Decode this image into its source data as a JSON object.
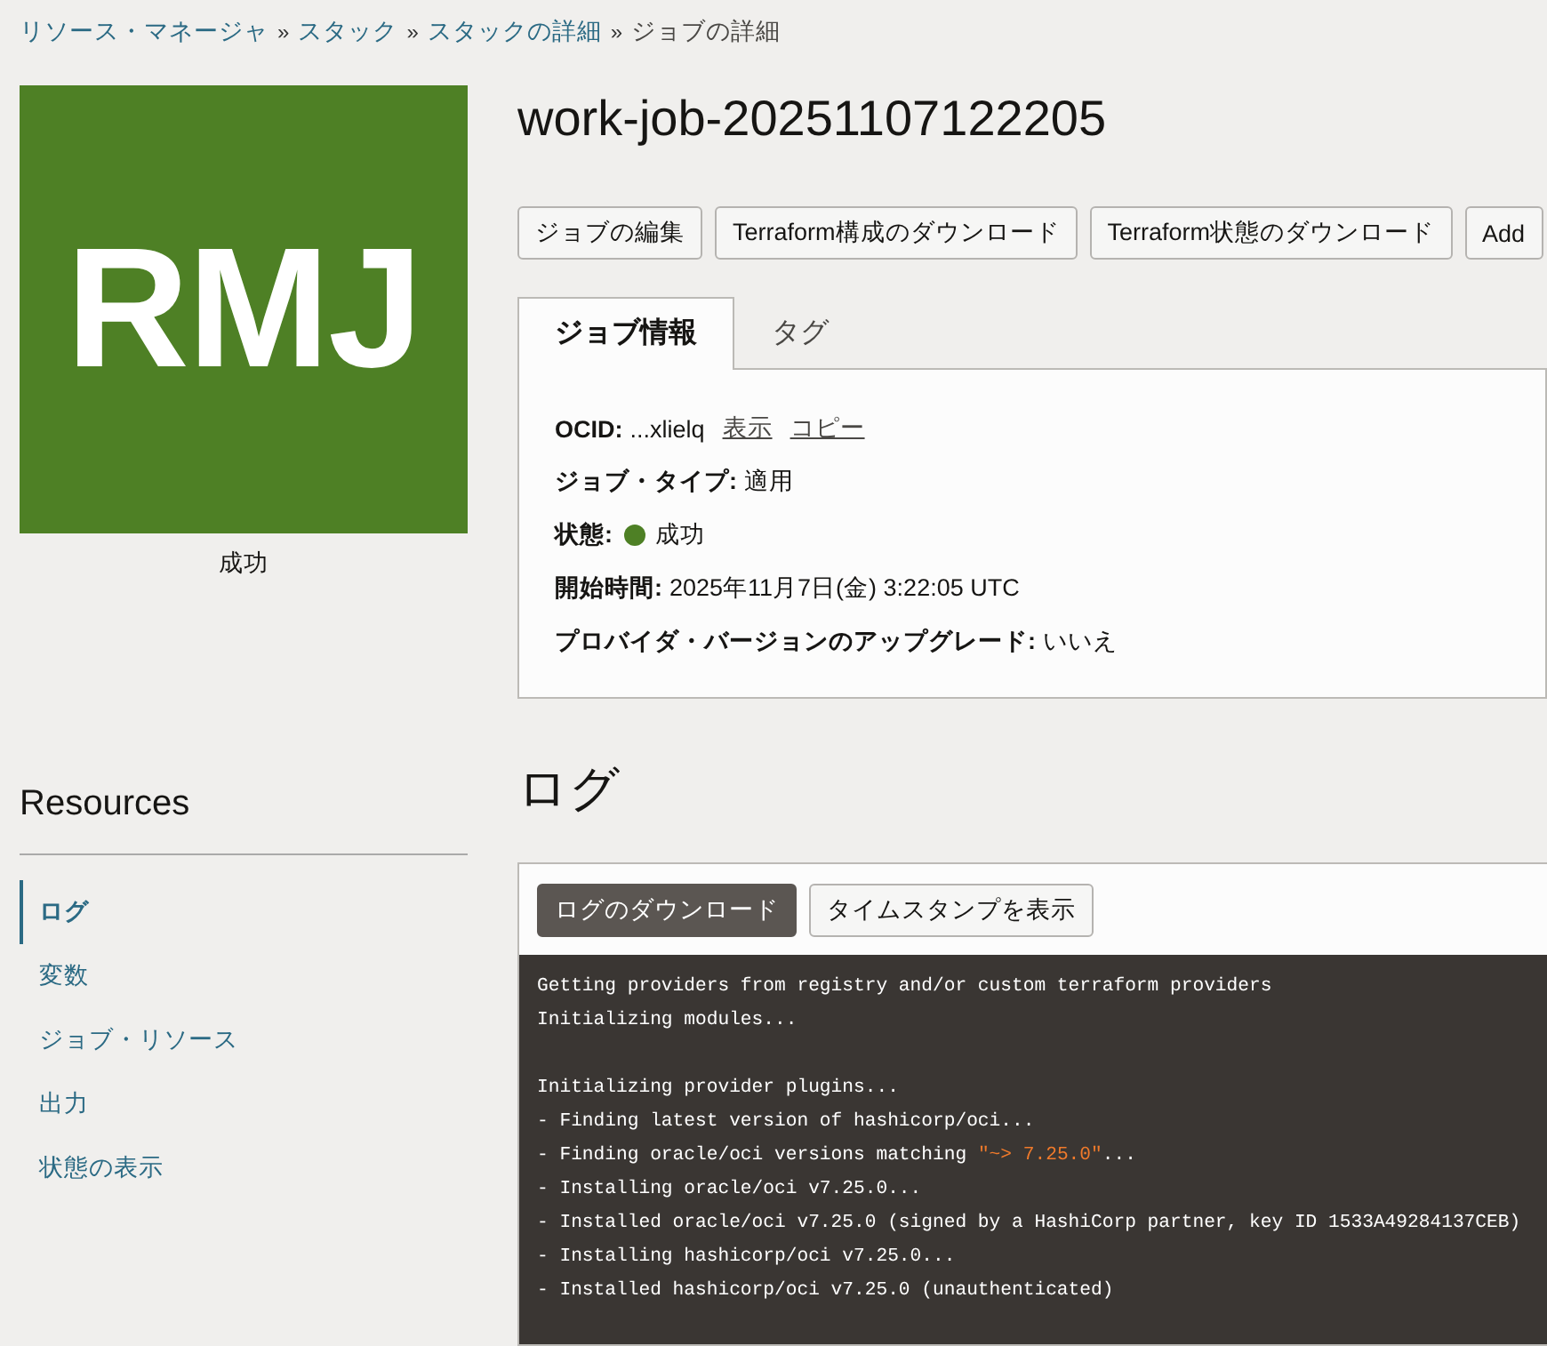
{
  "breadcrumb": [
    {
      "label": "リソース・マネージャ",
      "link": true
    },
    {
      "label": "スタック",
      "link": true
    },
    {
      "label": "スタックの詳細",
      "link": true
    },
    {
      "label": "ジョブの詳細",
      "link": false
    }
  ],
  "breadcrumb_separator": "»",
  "logo": {
    "text": "RMJ",
    "color": "#4e8025"
  },
  "logo_caption": "成功",
  "title": "work-job-20251107122205",
  "actions": [
    "ジョブの編集",
    "Terraform構成のダウンロード",
    "Terraform状態のダウンロード",
    "Add"
  ],
  "tabs": [
    {
      "label": "ジョブ情報",
      "selected": true
    },
    {
      "label": "タグ",
      "selected": false
    }
  ],
  "fields": [
    {
      "kind": "ocid",
      "label": "OCID:",
      "value": "...xlielq",
      "links": [
        "表示",
        "コピー"
      ]
    },
    {
      "kind": "text",
      "label": "ジョブ・タイプ:",
      "value": "適用"
    },
    {
      "kind": "status",
      "label": "状態:",
      "value": "成功",
      "color": "#4e8025"
    },
    {
      "kind": "text",
      "label": "開始時間:",
      "value": "2025年11月7日(金) 3:22:05 UTC"
    },
    {
      "kind": "text",
      "label": "プロバイダ・バージョンのアップグレード:",
      "value": "いいえ"
    }
  ],
  "resources": {
    "title": "Resources",
    "items": [
      {
        "label": "ログ",
        "selected": true
      },
      {
        "label": "変数",
        "selected": false
      },
      {
        "label": "ジョブ・リソース",
        "selected": false
      },
      {
        "label": "出力",
        "selected": false
      },
      {
        "label": "状態の表示",
        "selected": false
      }
    ]
  },
  "log": {
    "title": "ログ",
    "buttons": [
      {
        "label": "ログのダウンロード",
        "primary": true
      },
      {
        "label": "タイムスタンプを表示",
        "primary": false
      }
    ],
    "lines": [
      {
        "kind": "text",
        "parts": [
          {
            "text": "Getting providers from registry and/or custom terraform providers",
            "kind": "plain"
          }
        ]
      },
      {
        "kind": "text",
        "parts": [
          {
            "text": "Initializing modules...",
            "kind": "plain"
          }
        ]
      },
      {
        "kind": "blank"
      },
      {
        "kind": "text",
        "parts": [
          {
            "text": "Initializing provider plugins...",
            "kind": "plain"
          }
        ]
      },
      {
        "kind": "text",
        "parts": [
          {
            "text": "- Finding latest version of hashicorp/oci...",
            "kind": "plain"
          }
        ]
      },
      {
        "kind": "text",
        "parts": [
          {
            "text": "- Finding oracle/oci versions matching ",
            "kind": "plain"
          },
          {
            "text": "\"~> 7.25.0\"",
            "kind": "string"
          },
          {
            "text": "...",
            "kind": "plain"
          }
        ]
      },
      {
        "kind": "text",
        "parts": [
          {
            "text": "- Installing oracle/oci v7.25.0...",
            "kind": "plain"
          }
        ]
      },
      {
        "kind": "text",
        "parts": [
          {
            "text": "- Installed oracle/oci v7.25.0 (signed by a HashiCorp partner, key ID 1533A49284137CEB)",
            "kind": "plain"
          }
        ]
      },
      {
        "kind": "text",
        "parts": [
          {
            "text": "- Installing hashicorp/oci v7.25.0...",
            "kind": "plain"
          }
        ]
      },
      {
        "kind": "text",
        "parts": [
          {
            "text": "- Installed hashicorp/oci v7.25.0 (unauthenticated)",
            "kind": "plain"
          }
        ]
      }
    ]
  }
}
